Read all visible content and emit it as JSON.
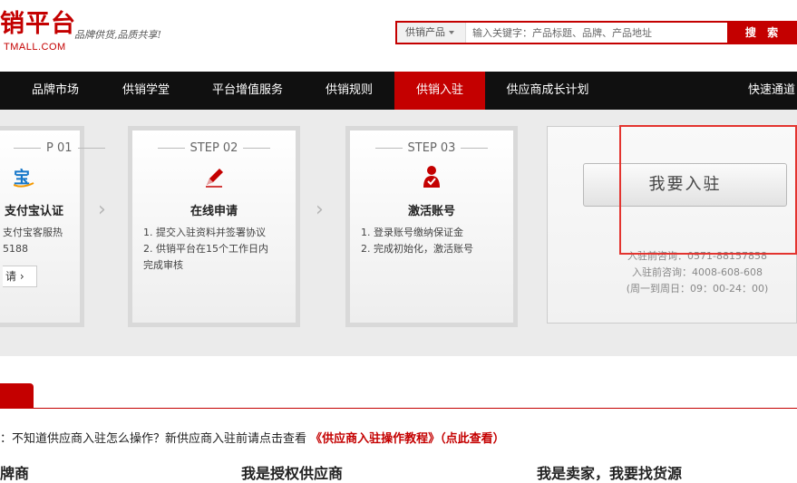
{
  "header": {
    "logo_title": "销平台",
    "logo_sub": "TMALL.COM",
    "logo_slogan": "品牌供货,品质共享!",
    "search_category": "供销产品",
    "search_placeholder": "输入关键字：产品标题、品牌、产品地址",
    "search_button": "搜 索"
  },
  "nav": {
    "items": [
      {
        "label": "品牌市场"
      },
      {
        "label": "供销学堂"
      },
      {
        "label": "平台增值服务"
      },
      {
        "label": "供销规则"
      },
      {
        "label": "供销入驻"
      },
      {
        "label": "供应商成长计划"
      },
      {
        "label": "快速通道"
      }
    ],
    "active": "供销入驻"
  },
  "steps": [
    {
      "label": "P 01",
      "title": "支付宝认证",
      "lines": [
        "支付宝客服热",
        "5188"
      ],
      "button": "请 ›"
    },
    {
      "label": "STEP 02",
      "title": "在线申请",
      "lines": [
        "1. 提交入驻资料并签署协议",
        "2. 供销平台在15个工作日内",
        "完成审核"
      ]
    },
    {
      "label": "STEP 03",
      "title": "激活账号",
      "lines": [
        "1. 登录账号缴纳保证金",
        "2. 完成初始化，激活账号"
      ]
    }
  ],
  "join": {
    "button": "我要入驻",
    "consult_1": "入驻前咨询：0571-88157858",
    "consult_2": "入驻前咨询：4008-608-608",
    "hours": "(周一到周日：09：00-24：00)"
  },
  "notice": {
    "prefix": "：不知道供应商入驻怎么操作？新供应商入驻前请点击查看",
    "link": "《供应商入驻操作教程》（点此查看）"
  },
  "roles": [
    "牌商",
    "我是授权供应商",
    "我是卖家，我要找货源"
  ]
}
